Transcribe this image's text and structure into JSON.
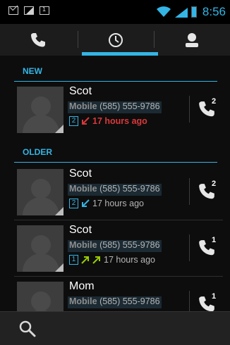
{
  "status_bar": {
    "time": "8:56",
    "icons": [
      "gmail-icon",
      "gallery-icon",
      "calendar-icon",
      "wifi-icon",
      "signal-icon",
      "battery-icon"
    ],
    "calendar_day": "1"
  },
  "tabs": [
    {
      "name": "phone",
      "icon": "phone-icon",
      "selected": false
    },
    {
      "name": "call-log",
      "icon": "clock-icon",
      "selected": true
    },
    {
      "name": "contacts",
      "icon": "person-icon",
      "selected": false
    }
  ],
  "sections": {
    "new": "NEW",
    "older": "OLDER"
  },
  "calls": [
    {
      "name": "Scot",
      "type": "Mobile",
      "number": "(585) 555-9786",
      "count": "2",
      "direction": "missed",
      "time": "17 hours ago",
      "sim_badge": "2"
    },
    {
      "name": "Scot",
      "type": "Mobile",
      "number": "(585) 555-9786",
      "count": "2",
      "direction": "incoming",
      "time": "17 hours ago",
      "sim_badge": "2"
    },
    {
      "name": "Scot",
      "type": "Mobile",
      "number": "(585) 555-9786",
      "count": "1",
      "direction": "outgoing",
      "time": "17 hours ago",
      "sim_badge": "1"
    },
    {
      "name": "Mom",
      "type": "Mobile",
      "number": "(585) 555-9786",
      "count": "",
      "direction": "",
      "time": "",
      "sim_badge": "1"
    }
  ],
  "colors": {
    "accent": "#33b5e5",
    "missed": "#d9383a",
    "outgoing": "#99cc00"
  }
}
